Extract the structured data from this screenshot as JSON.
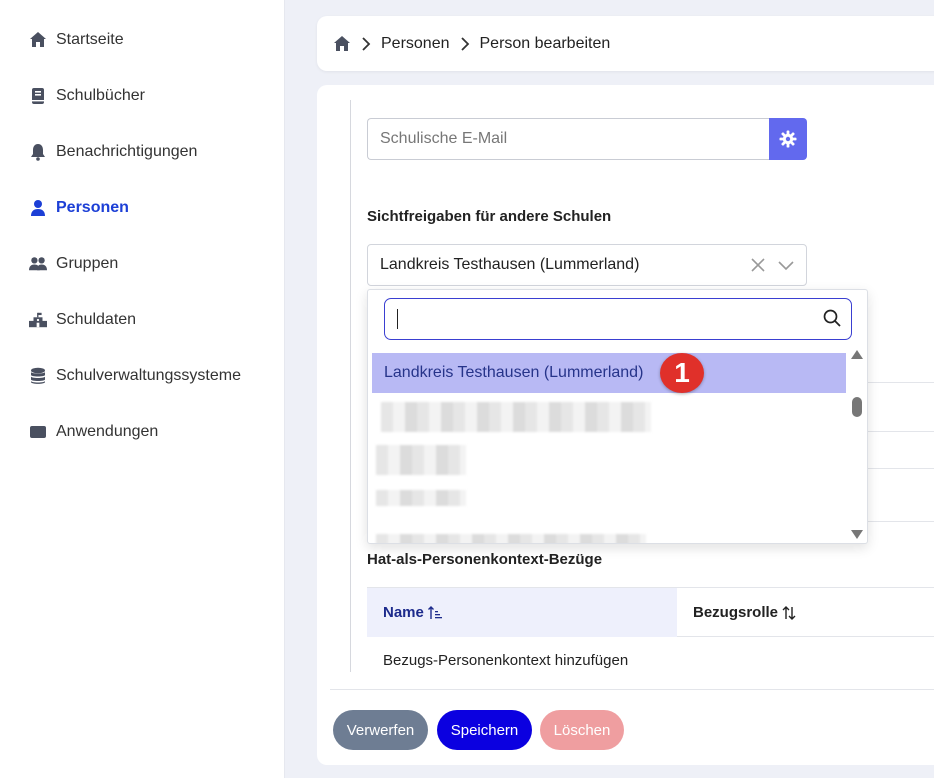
{
  "sidebar": {
    "items": [
      {
        "label": "Startseite",
        "icon": "home-icon"
      },
      {
        "label": "Schulbücher",
        "icon": "book-icon"
      },
      {
        "label": "Benachrichtigungen",
        "icon": "bell-icon"
      },
      {
        "label": "Personen",
        "icon": "user-icon",
        "active": true
      },
      {
        "label": "Gruppen",
        "icon": "users-icon"
      },
      {
        "label": "Schuldaten",
        "icon": "school-icon"
      },
      {
        "label": "Schulverwaltungssysteme",
        "icon": "database-icon"
      },
      {
        "label": "Anwendungen",
        "icon": "window-icon"
      }
    ],
    "active_color": "#1c3fd6"
  },
  "breadcrumb": {
    "items": [
      "Personen",
      "Person bearbeiten"
    ]
  },
  "form": {
    "email_placeholder": "Schulische E-Mail",
    "visibility_title": "Sichtfreigaben für andere Schulen",
    "visibility_selected": "Landkreis Testhausen (Lummerland)",
    "relations_title": "Hat-als-Personenkontext-Bezüge"
  },
  "dropdown": {
    "search_value": "",
    "options": [
      "Landkreis Testhausen (Lummerland)"
    ],
    "step_badge": "1"
  },
  "table": {
    "col_name": "Name",
    "col_role": "Bezugsrolle",
    "add_link": "Bezugs-Personenkontext hinzufügen"
  },
  "buttons": {
    "discard": "Verwerfen",
    "save": "Speichern",
    "delete": "Löschen"
  },
  "colors": {
    "accent": "#6269ee",
    "save": "#0b00e0",
    "discard": "#6e7d93",
    "delete": "#ef9ea0",
    "option_highlight": "#b8b9f4",
    "badge": "#e0302a"
  }
}
